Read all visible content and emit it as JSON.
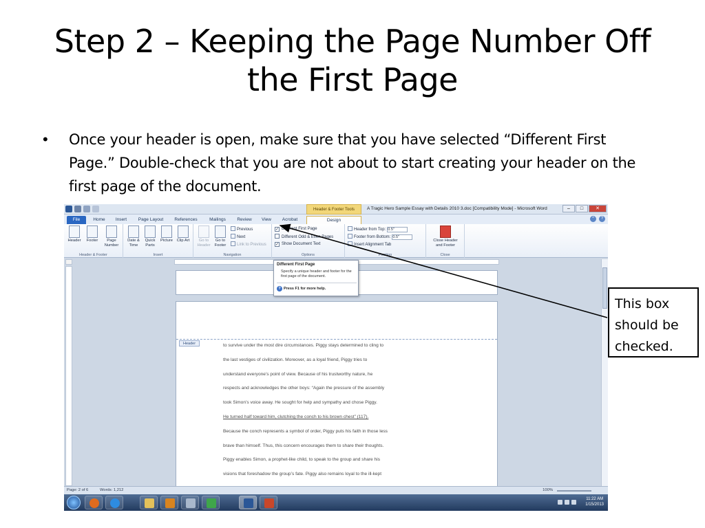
{
  "slide": {
    "title": "Step 2 – Keeping the Page Number Off the First Page",
    "bullet": "Once your header is open, make sure that you have selected “Different First Page.”  Double-check that you are not about to start creating your header on the first page of the document.",
    "callout": "This box should be checked."
  },
  "word": {
    "context_tab": "Header & Footer Tools",
    "doc_title": "A Tragic Hero Sample Essay with Details 2010 3.doc [Compatibility Mode] - Microsoft Word",
    "tabs": [
      "File",
      "Home",
      "Insert",
      "Page Layout",
      "References",
      "Mailings",
      "Review",
      "View",
      "Acrobat",
      "Design"
    ],
    "groups": {
      "header_footer": {
        "label": "Header & Footer",
        "buttons": [
          "Header",
          "Footer",
          "Page Number"
        ]
      },
      "insert": {
        "label": "Insert",
        "buttons": [
          "Date & Time",
          "Quick Parts",
          "Picture",
          "Clip Art"
        ]
      },
      "navigation": {
        "label": "Navigation",
        "buttons": [
          "Go to Header",
          "Go to Footer"
        ],
        "items": [
          "Previous",
          "Next",
          "Link to Previous"
        ]
      },
      "options": {
        "label": "Options",
        "checkboxes": [
          {
            "label": "Different First Page",
            "checked": true
          },
          {
            "label": "Different Odd & Even Pages",
            "checked": false
          },
          {
            "label": "Show Document Text",
            "checked": true
          }
        ]
      },
      "position": {
        "label": "Position",
        "header_from_top_label": "Header from Top:",
        "header_from_top_value": "0.5\"",
        "footer_from_bottom_label": "Footer from Bottom:",
        "footer_from_bottom_value": "0.5\"",
        "insert_alignment_tab": "Insert Alignment Tab"
      },
      "close": {
        "label": "Close",
        "button": "Close Header and Footer"
      }
    },
    "tooltip": {
      "title": "Different First Page",
      "description": "Specify a unique header and footer for the first page of the document.",
      "help": "Press F1 for more help."
    },
    "header_tag": "Header",
    "document_lines": [
      "to survive under the most dire circumstances.  Piggy stays determined to cling to",
      "the last vestiges of civilization.  Moreover, as a loyal friend, Piggy tries to",
      "understand everyone’s point of view.  Because of his trustworthy nature, he",
      "respects and acknowledges the other boys: “Again the pressure of the assembly",
      "took Simon’s voice away.  He sought for help and sympathy and chose Piggy.",
      "He turned half toward him, clutching the conch to his brown chest” (117).",
      "Because the conch represents a symbol of order, Piggy puts his faith in those less",
      "brave than himself.  Thus, this concern encourages them to share their thoughts.",
      "Piggy enables Simon, a prophet-like child, to speak to the group and share his",
      "visions that foreshadow the group’s fate.  Piggy also remains loyal to the ill-kept"
    ],
    "status": {
      "page": "Page: 2 of 6",
      "words": "Words: 1,212",
      "zoom": "100%"
    },
    "clock": {
      "time": "11:22 AM",
      "date": "1/15/2013"
    }
  }
}
